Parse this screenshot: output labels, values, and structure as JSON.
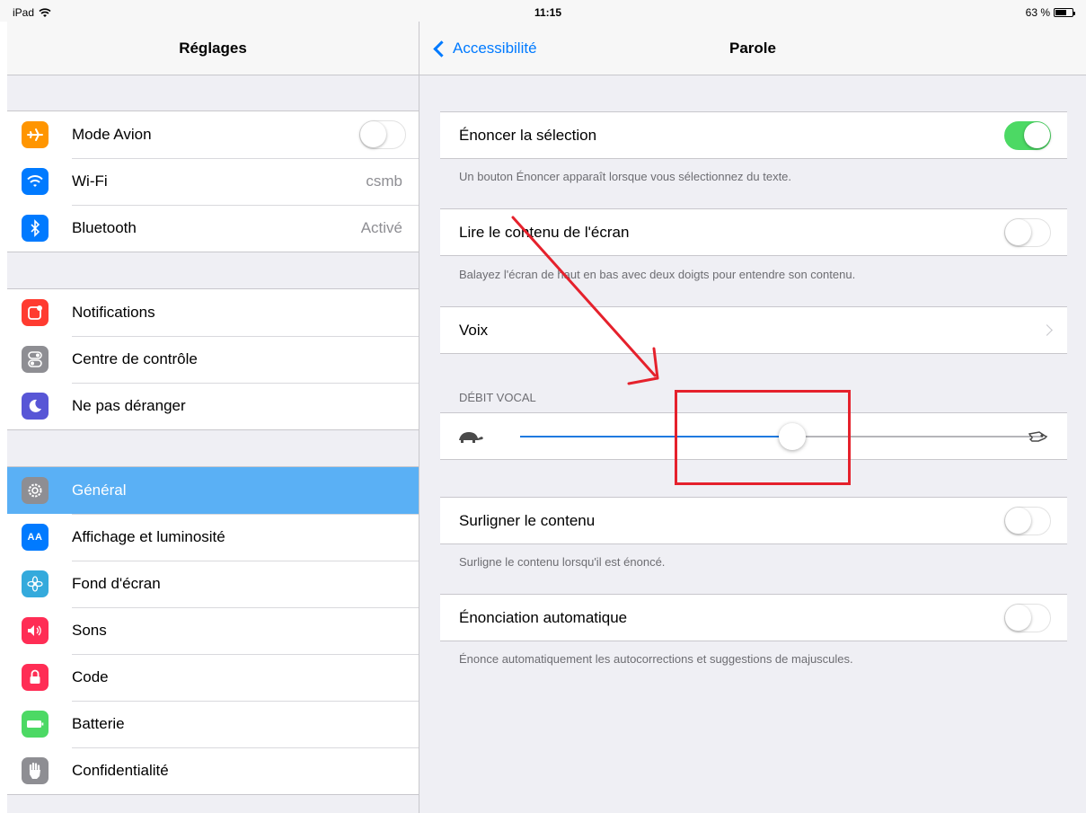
{
  "status_bar": {
    "device": "iPad",
    "time": "11:15",
    "battery": "63 %"
  },
  "left": {
    "title": "Réglages",
    "groups": [
      [
        {
          "label": "Mode Avion",
          "icon": "airplane-icon",
          "color": "#ff9500",
          "type": "toggle",
          "on": false
        },
        {
          "label": "Wi-Fi",
          "icon": "wifi-icon",
          "color": "#007aff",
          "value": "csmb"
        },
        {
          "label": "Bluetooth",
          "icon": "bluetooth-icon",
          "color": "#007aff",
          "value": "Activé"
        }
      ],
      [
        {
          "label": "Notifications",
          "icon": "notifications-icon",
          "color": "#ff3b30"
        },
        {
          "label": "Centre de contrôle",
          "icon": "control-center-icon",
          "color": "#8e8e93"
        },
        {
          "label": "Ne pas déranger",
          "icon": "moon-icon",
          "color": "#5856d6"
        }
      ],
      [
        {
          "label": "Général",
          "icon": "gear-icon",
          "color": "#8e8e93",
          "selected": true
        },
        {
          "label": "Affichage et luminosité",
          "icon": "display-icon",
          "color": "#007aff"
        },
        {
          "label": "Fond d'écran",
          "icon": "wallpaper-icon",
          "color": "#34aadc"
        },
        {
          "label": "Sons",
          "icon": "speaker-icon",
          "color": "#ff2d55"
        },
        {
          "label": "Code",
          "icon": "lock-icon",
          "color": "#ff2d55"
        },
        {
          "label": "Batterie",
          "icon": "battery-icon",
          "color": "#4cd964"
        },
        {
          "label": "Confidentialité",
          "icon": "hand-icon",
          "color": "#8e8e93"
        }
      ]
    ]
  },
  "right": {
    "back_label": "Accessibilité",
    "title": "Parole",
    "speak_selection": {
      "label": "Énoncer la sélection",
      "on": true,
      "footer": "Un bouton Énoncer apparaît lorsque vous sélectionnez du texte."
    },
    "speak_screen": {
      "label": "Lire le contenu de l'écran",
      "on": false,
      "footer": "Balayez l'écran de haut en bas avec deux doigts pour entendre son contenu."
    },
    "voices": {
      "label": "Voix"
    },
    "speaking_rate": {
      "header": "DÉBIT VOCAL",
      "value": 0.52
    },
    "highlight": {
      "label": "Surligner le contenu",
      "on": false,
      "footer": "Surligne le contenu lorsqu'il est énoncé."
    },
    "auto_speak": {
      "label": "Énonciation automatique",
      "on": false,
      "footer": "Énonce automatiquement les autocorrections et suggestions de majuscules."
    }
  },
  "annotation": {
    "color": "#e5212c"
  }
}
